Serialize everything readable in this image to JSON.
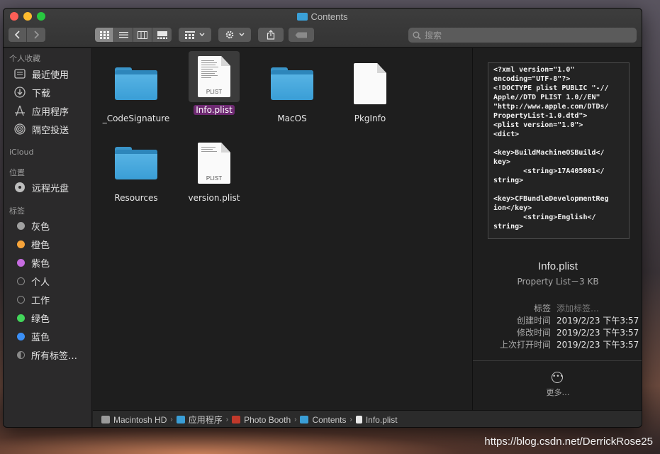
{
  "window": {
    "title": "Contents"
  },
  "toolbar": {
    "back_icon": "chevron-left",
    "forward_icon": "chevron-right",
    "view_icons": [
      "grid-view",
      "list-view",
      "column-view",
      "gallery-view"
    ],
    "arrange_icon": "grid-group",
    "action_icon": "gear",
    "share_icon": "share",
    "tag_icon": "tag"
  },
  "search": {
    "placeholder": "搜索"
  },
  "sidebar": {
    "favorites_title": "个人收藏",
    "favorites": [
      {
        "label": "最近使用",
        "icon": "recents-icon"
      },
      {
        "label": "下载",
        "icon": "download-icon"
      },
      {
        "label": "应用程序",
        "icon": "applications-icon"
      },
      {
        "label": "隔空投送",
        "icon": "airdrop-icon"
      }
    ],
    "icloud_title": "iCloud",
    "locations_title": "位置",
    "locations": [
      {
        "label": "远程光盘",
        "icon": "disc-icon"
      }
    ],
    "tags_title": "标签",
    "tags": [
      {
        "label": "灰色",
        "color": "#a0a0a0"
      },
      {
        "label": "橙色",
        "color": "#f7a43a"
      },
      {
        "label": "紫色",
        "color": "#c66ce0"
      },
      {
        "label": "个人",
        "color": "none"
      },
      {
        "label": "工作",
        "color": "none"
      },
      {
        "label": "绿色",
        "color": "#42d65a"
      },
      {
        "label": "蓝色",
        "color": "#3b8ff6"
      },
      {
        "label": "所有标签…",
        "color": "all"
      }
    ]
  },
  "files": [
    {
      "name": "_CodeSignature",
      "type": "folder",
      "selected": false
    },
    {
      "name": "Info.plist",
      "type": "plist",
      "ext_label": "PLIST",
      "selected": true
    },
    {
      "name": "MacOS",
      "type": "folder",
      "selected": false
    },
    {
      "name": "PkgInfo",
      "type": "blank",
      "selected": false
    },
    {
      "name": "Resources",
      "type": "folder",
      "selected": false
    },
    {
      "name": "version.plist",
      "type": "plist",
      "ext_label": "PLIST",
      "selected": false
    }
  ],
  "preview": {
    "code": "<?xml version=\"1.0\"\nencoding=\"UTF-8\"?>\n<!DOCTYPE plist PUBLIC \"-//\nApple//DTD PLIST 1.0//EN\"\n\"http://www.apple.com/DTDs/\nPropertyList-1.0.dtd\">\n<plist version=\"1.0\">\n<dict>\n\n<key>BuildMachineOSBuild</\nkey>\n       <string>17A405001</\nstring>\n\n<key>CFBundleDevelopmentReg\nion</key>\n       <string>English</\nstring>",
    "name": "Info.plist",
    "kind": "Property List－3 KB",
    "meta": [
      {
        "key": "标签",
        "value": "添加标签…",
        "placeholder": true
      },
      {
        "key": "创建时间",
        "value": "2019/2/23 下午3:57",
        "placeholder": false
      },
      {
        "key": "修改时间",
        "value": "2019/2/23 下午3:57",
        "placeholder": false
      },
      {
        "key": "上次打开时间",
        "value": "2019/2/23 下午3:57",
        "placeholder": false
      }
    ],
    "more_label": "更多…"
  },
  "pathbar": [
    {
      "label": "Macintosh HD",
      "icon": "disk-icon",
      "color": "#9a9a9a"
    },
    {
      "label": "应用程序",
      "icon": "applications-folder-icon",
      "color": "#3a9ed6"
    },
    {
      "label": "Photo Booth",
      "icon": "photo-booth-icon",
      "color": "#c0392b"
    },
    {
      "label": "Contents",
      "icon": "folder-icon",
      "color": "#3a9ed6"
    },
    {
      "label": "Info.plist",
      "icon": "document-icon",
      "color": "#e8e8e8"
    }
  ],
  "watermark": "https://blog.csdn.net/DerrickRose25"
}
